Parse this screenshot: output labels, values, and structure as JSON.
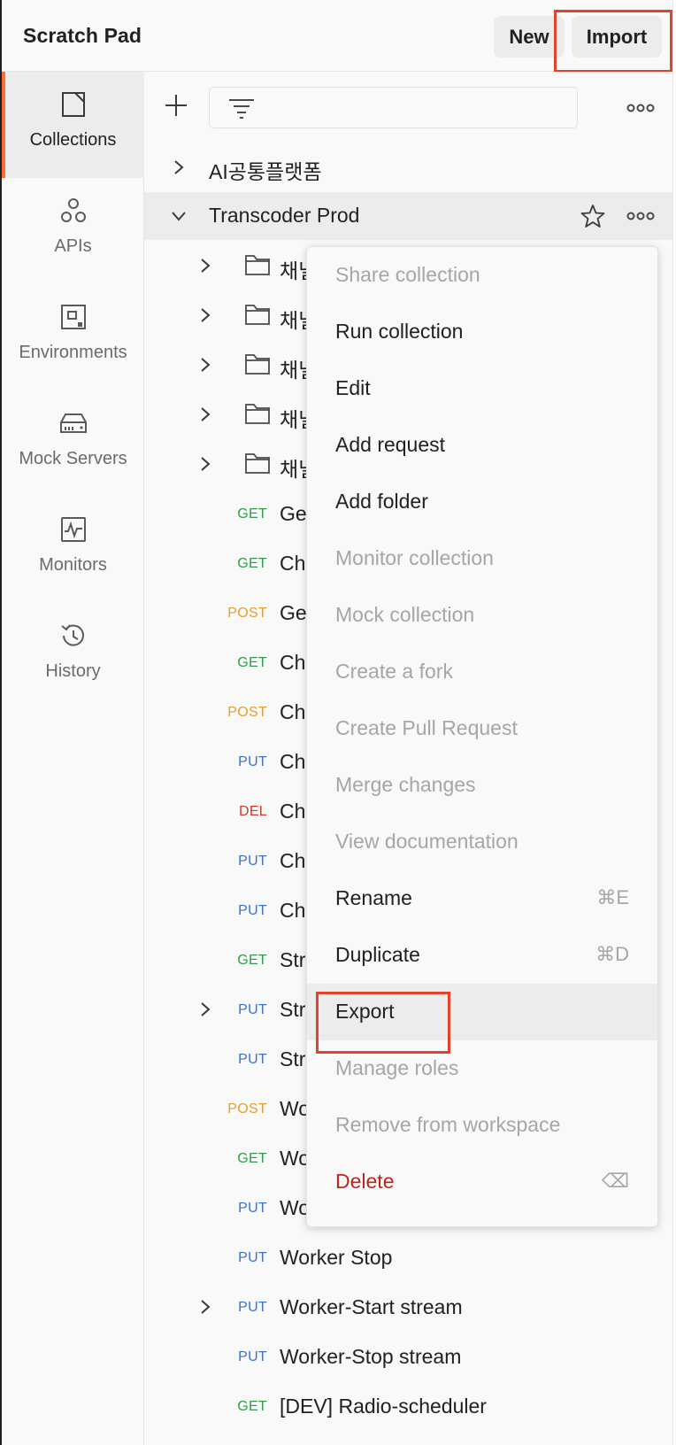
{
  "header": {
    "title": "Scratch Pad",
    "new_label": "New",
    "import_label": "Import"
  },
  "sidebar": {
    "items": [
      {
        "label": "Collections",
        "icon": "collections-icon"
      },
      {
        "label": "APIs",
        "icon": "apis-icon"
      },
      {
        "label": "Environments",
        "icon": "environments-icon"
      },
      {
        "label": "Mock Servers",
        "icon": "mock-servers-icon"
      },
      {
        "label": "Monitors",
        "icon": "monitors-icon"
      },
      {
        "label": "History",
        "icon": "history-icon"
      }
    ],
    "active": "Collections"
  },
  "collections": [
    {
      "name": "AI공통플랫폼",
      "expanded": false
    },
    {
      "name": "Transcoder Prod",
      "expanded": true
    }
  ],
  "items": [
    {
      "type": "folder",
      "name": "채널"
    },
    {
      "type": "folder",
      "name": "채널"
    },
    {
      "type": "folder",
      "name": "채널"
    },
    {
      "type": "folder",
      "name": "채널"
    },
    {
      "type": "folder",
      "name": "채널"
    },
    {
      "method": "GET",
      "name": "Ge"
    },
    {
      "method": "GET",
      "name": "Ch"
    },
    {
      "method": "POST",
      "name": "Ge"
    },
    {
      "method": "GET",
      "name": "Ch"
    },
    {
      "method": "POST",
      "name": "Ch"
    },
    {
      "method": "PUT",
      "name": "Ch"
    },
    {
      "method": "DEL",
      "name": "Ch"
    },
    {
      "method": "PUT",
      "name": "Ch"
    },
    {
      "method": "PUT",
      "name": "Ch"
    },
    {
      "method": "GET",
      "name": "Str"
    },
    {
      "method": "PUT",
      "name": "Str",
      "expandable": true
    },
    {
      "method": "PUT",
      "name": "Str"
    },
    {
      "method": "POST",
      "name": "Wo"
    },
    {
      "method": "GET",
      "name": "Wo"
    },
    {
      "method": "PUT",
      "name": "Wo"
    },
    {
      "method": "PUT",
      "name": "Worker Stop"
    },
    {
      "method": "PUT",
      "name": "Worker-Start stream",
      "expandable": true
    },
    {
      "method": "PUT",
      "name": "Worker-Stop stream"
    },
    {
      "method": "GET",
      "name": "[DEV] Radio-scheduler"
    }
  ],
  "context_menu": {
    "items": [
      {
        "label": "Share collection",
        "state": "disabled"
      },
      {
        "label": "Run collection",
        "state": "enabled"
      },
      {
        "label": "Edit",
        "state": "enabled"
      },
      {
        "label": "Add request",
        "state": "enabled"
      },
      {
        "label": "Add folder",
        "state": "enabled"
      },
      {
        "label": "Monitor collection",
        "state": "disabled"
      },
      {
        "label": "Mock collection",
        "state": "disabled"
      },
      {
        "label": "Create a fork",
        "state": "disabled"
      },
      {
        "label": "Create Pull Request",
        "state": "disabled"
      },
      {
        "label": "Merge changes",
        "state": "disabled"
      },
      {
        "label": "View documentation",
        "state": "disabled"
      },
      {
        "label": "Rename",
        "state": "enabled",
        "shortcut": "⌘E"
      },
      {
        "label": "Duplicate",
        "state": "enabled",
        "shortcut": "⌘D"
      },
      {
        "label": "Export",
        "state": "highlighted"
      },
      {
        "label": "Manage roles",
        "state": "disabled"
      },
      {
        "label": "Remove from workspace",
        "state": "disabled"
      },
      {
        "label": "Delete",
        "state": "danger",
        "shortcut": "⌫"
      }
    ]
  },
  "colors": {
    "accent": "#ff6c37",
    "highlight_box": "#e2432a",
    "get": "#2e9d4a",
    "post": "#e3a12a",
    "put": "#3873d8",
    "del": "#d23a2a",
    "delete_text": "#c0241c"
  }
}
